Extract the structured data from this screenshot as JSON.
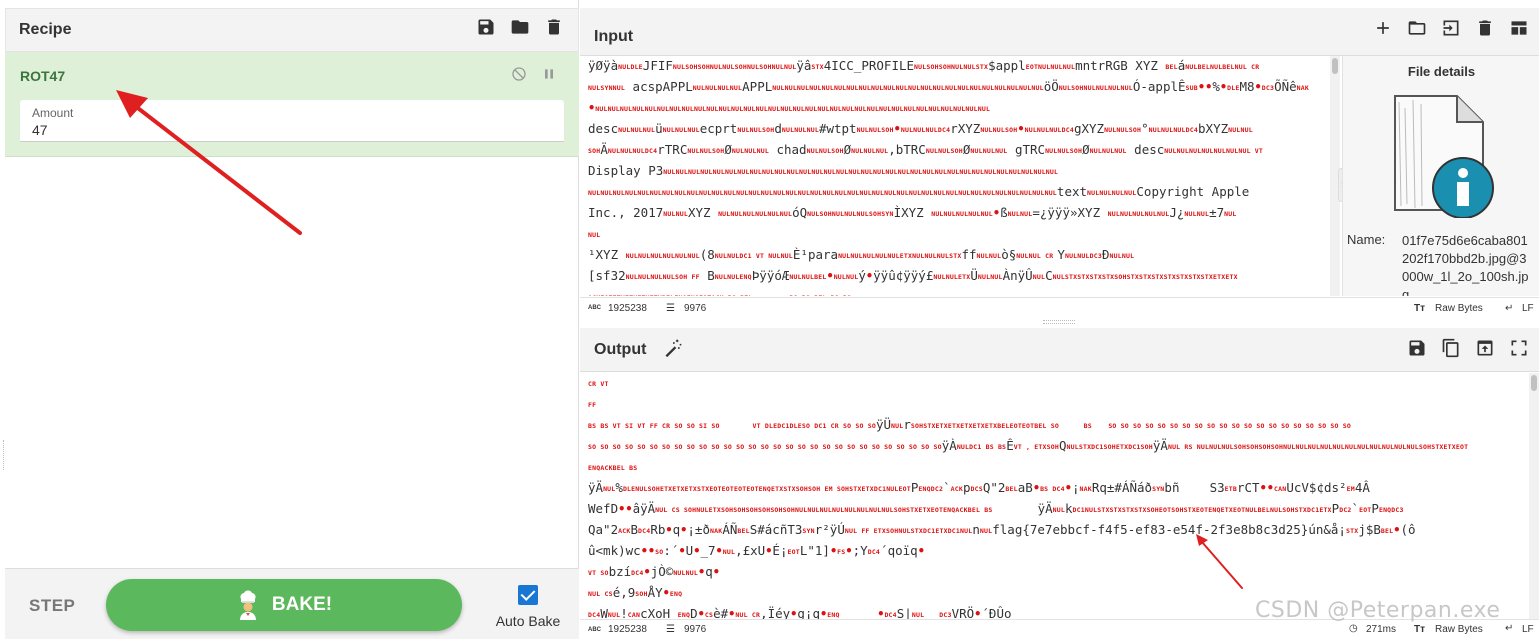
{
  "recipe": {
    "title": "Recipe",
    "operation": {
      "name": "ROT47",
      "arg_label": "Amount",
      "arg_value": "47"
    },
    "step_label": "STEP",
    "bake_label": "BAKE!",
    "autobake_label": "Auto Bake",
    "autobake_checked": true
  },
  "input": {
    "title": "Input",
    "status": {
      "length": "1925238",
      "lines": "9976",
      "encoding": "Raw Bytes",
      "eol": "LF"
    },
    "lines": [
      "ÿØÿàNULDLEJFIFNULSOHSOHNULNULSOHNULSOHNULNULÿâSTX4ICC_PROFILENULSOHSOHNULNULSTX$applEOTNULNULNULmntrRGB XYZ BELáNULBELNULBELNUL CR",
      "NULSYNNUL acspAPPLNULNULNULNULAPPL…ÖÖNULSOHNULNULNULNULÓ-applÊSUB••%•DLEM8•DC3ÕÑêNAK",
      "•NULNULNULNUL…",
      "descNULNULNULüNULNULNULecprtNULNULSOHdNULNULNUL#wtptNULNULSOH•NULNULNULDC4rXYZ…gXYZ…°…bXYZNULNUL",
      "SOHÄNULNULNULDC4rTRCNULNULSOHØNULNULNUL chadNULNULSOHØNULNULNUL,bTRC…ØNULNULNUL gTRC…ØNULNULNUL desc…VT",
      "Display P3",
      "NULNUL…textNULNULNULNULCopyright Apple",
      "Inc., 2017NULNULXYZ…ÓQNULSOHNULNULNULSOHSYNÌXYZ…•ßNULNUL=¿ÿÿÿ»XYZ…J¿NULNUL±7NUL",
      "NUL",
      "¹XYZ…(8NULNULDC1VTNULNULÈ¹para…ò§NULNULCRYNULNULDC3ÐNULNUL",
      "[sf32…B…ÞÿÿóÆ…•NULNULý•ÿÿû¢ÿÿý£…ÜNULNULÀnÿÛNULCNUL…ETX…",
      "ACKEOTETX…BS BEL BS BS BEL BS BS"
    ]
  },
  "file_details": {
    "title": "File details",
    "name_label": "Name:",
    "name_value": "01f7e75d6e6caba801202f170bbd2b.jpg@3000w_1l_2o_100sh.jpg"
  },
  "output": {
    "title": "Output",
    "status": {
      "length": "1925238",
      "lines": "9976",
      "time": "271ms",
      "encoding": "Raw Bytes",
      "eol": "LF"
    },
    "flag": "flag{7e7ebbcf-f4f5-ef83-e54f-2f3e8b8c3d25}"
  },
  "watermark": "CSDN @Peterpan.exe",
  "colors": {
    "op_bg": "#dff0d8",
    "op_text": "#3c763d",
    "bake": "#5cb85c",
    "control_char": "#dd1111",
    "arrow": "#e02020"
  }
}
